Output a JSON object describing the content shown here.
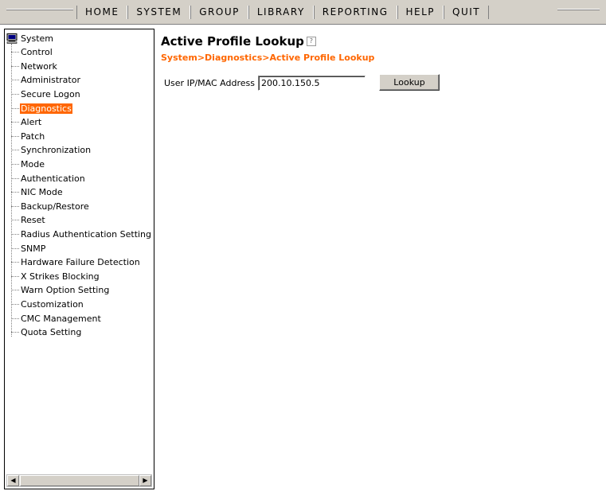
{
  "topnav": {
    "items": [
      "HOME",
      "SYSTEM",
      "GROUP",
      "LIBRARY",
      "REPORTING",
      "HELP",
      "QUIT"
    ]
  },
  "sidebar": {
    "root_label": "System",
    "items": [
      {
        "label": "Control"
      },
      {
        "label": "Network"
      },
      {
        "label": "Administrator"
      },
      {
        "label": "Secure Logon"
      },
      {
        "label": "Diagnostics",
        "selected": true
      },
      {
        "label": "Alert"
      },
      {
        "label": "Patch"
      },
      {
        "label": "Synchronization"
      },
      {
        "label": "Mode"
      },
      {
        "label": "Authentication"
      },
      {
        "label": "NIC Mode"
      },
      {
        "label": "Backup/Restore"
      },
      {
        "label": "Reset"
      },
      {
        "label": "Radius Authentication Setting"
      },
      {
        "label": "SNMP"
      },
      {
        "label": "Hardware Failure Detection"
      },
      {
        "label": "X Strikes Blocking"
      },
      {
        "label": "Warn Option Setting"
      },
      {
        "label": "Customization"
      },
      {
        "label": "CMC Management"
      },
      {
        "label": "Quota Setting"
      }
    ]
  },
  "main": {
    "title": "Active Profile Lookup",
    "help_icon": "?",
    "breadcrumb": "System>Diagnostics>Active Profile Lookup",
    "field_label": "User IP/MAC Address",
    "field_value": "200.10.150.5",
    "button_label": "Lookup"
  },
  "colors": {
    "accent": "#ff6600",
    "toolbar_bg": "#d4d0c8"
  }
}
